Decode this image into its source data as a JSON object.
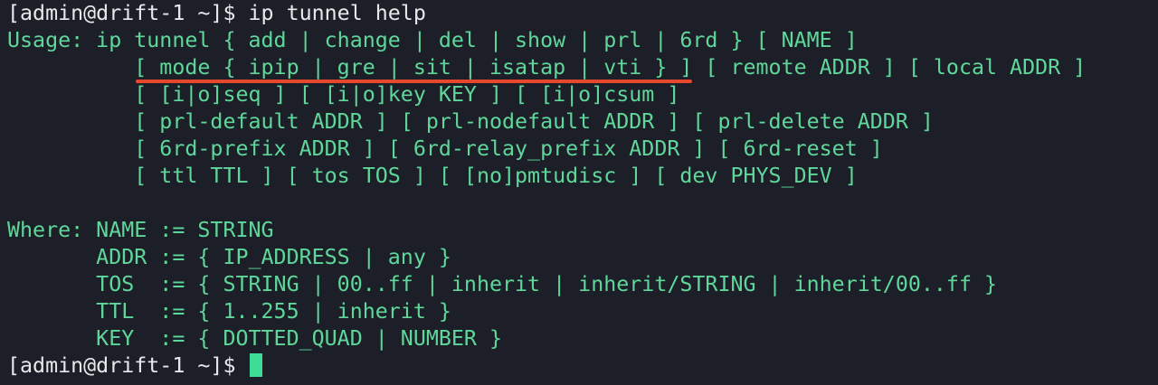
{
  "terminal": {
    "command_prompt": "[admin@drift-1 ~]$ ",
    "command": "ip tunnel help",
    "output_lines": [
      "Usage: ip tunnel { add | change | del | show | prl | 6rd } [ NAME ]",
      "          [ mode { ipip | gre | sit | isatap | vti } ] [ remote ADDR ] [ local ADDR ]",
      "          [ [i|o]seq ] [ [i|o]key KEY ] [ [i|o]csum ]",
      "          [ prl-default ADDR ] [ prl-nodefault ADDR ] [ prl-delete ADDR ]",
      "          [ 6rd-prefix ADDR ] [ 6rd-relay_prefix ADDR ] [ 6rd-reset ]",
      "          [ ttl TTL ] [ tos TOS ] [ [no]pmtudisc ] [ dev PHYS_DEV ]",
      "",
      "Where: NAME := STRING",
      "       ADDR := { IP_ADDRESS | any }",
      "       TOS  := { STRING | 00..ff | inherit | inherit/STRING | inherit/00..ff }",
      "       TTL  := { 1..255 | inherit }",
      "       KEY  := { DOTTED_QUAD | NUMBER }"
    ],
    "final_prompt": "[admin@drift-1 ~]$ "
  },
  "colors": {
    "background": "#1d1f28",
    "output_text": "#5fd79a",
    "prompt_text": "#e8e8ea",
    "cursor": "#3ddc97",
    "annotation_underline": "#e5482c"
  }
}
